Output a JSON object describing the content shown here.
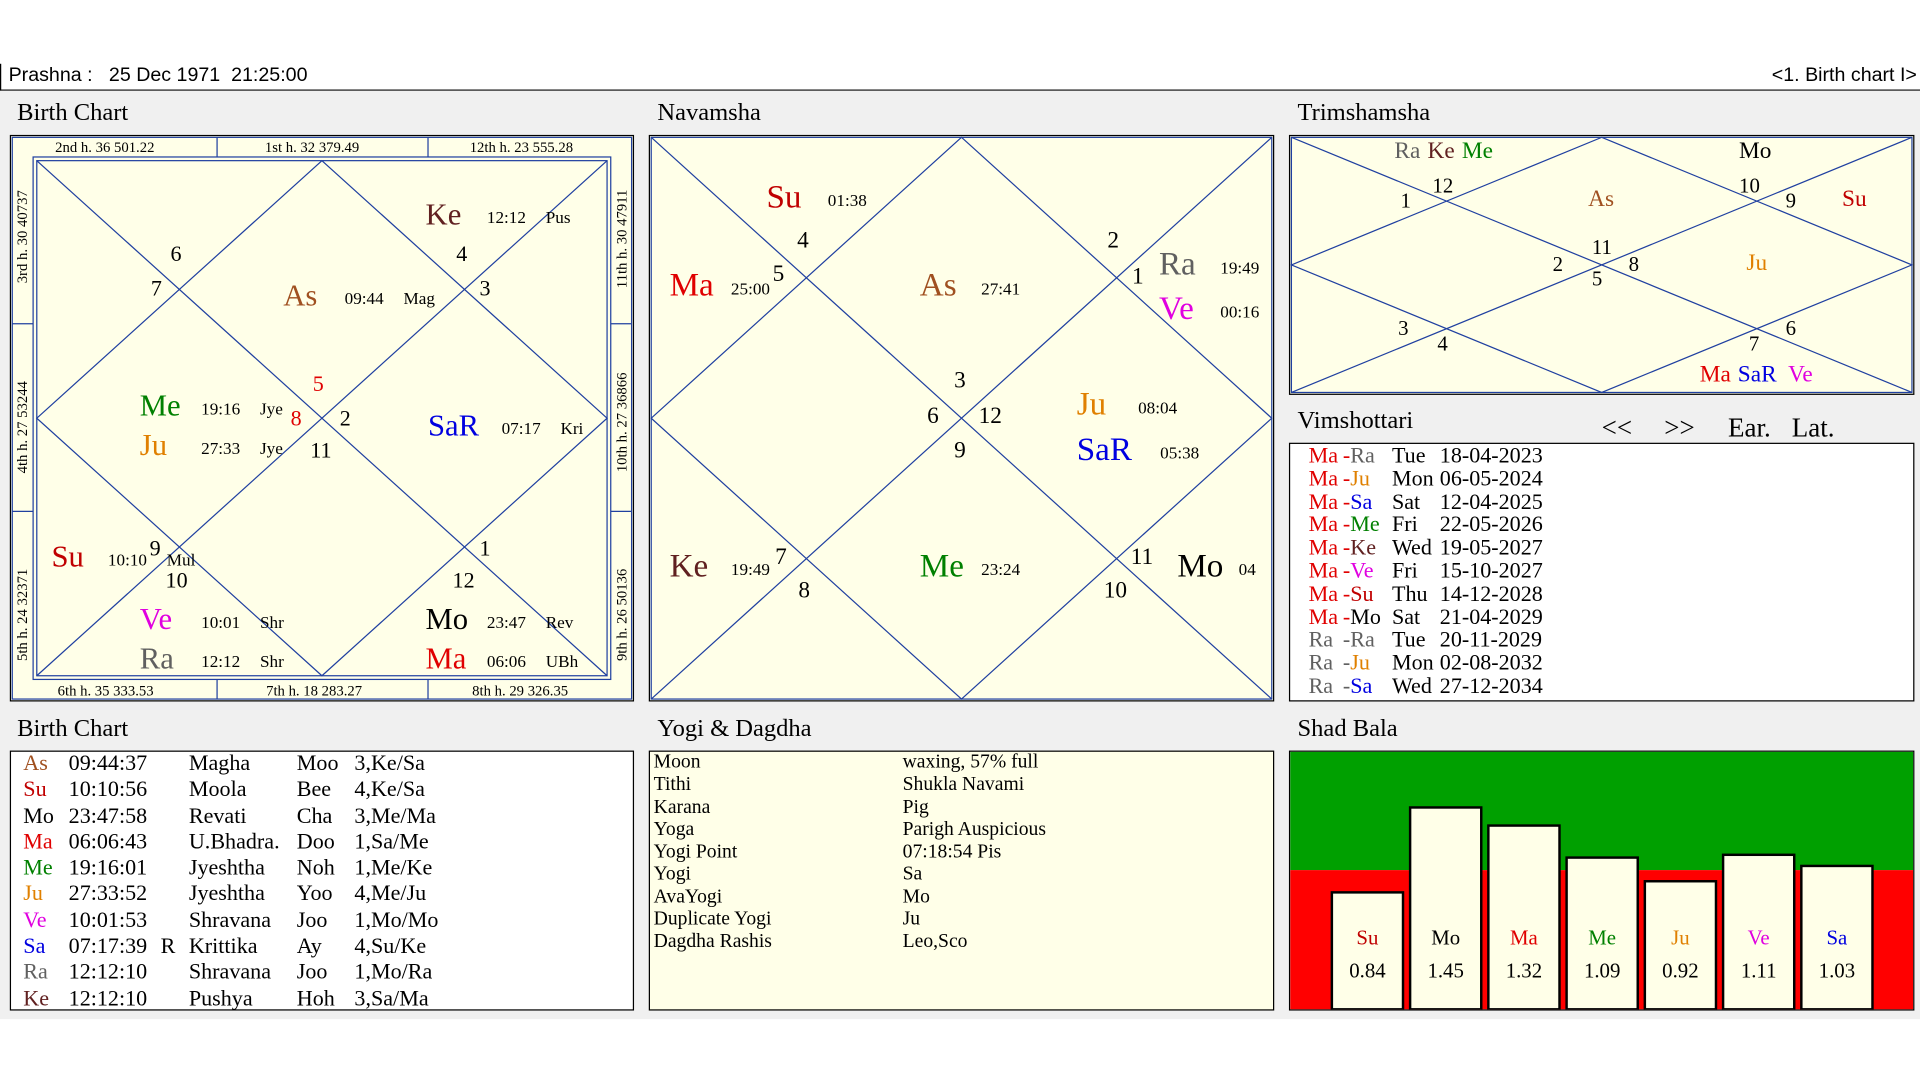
{
  "titlebar": {
    "left": "Prashna :   25 Dec 1971  21:25:00",
    "right": "<1. Birth chart I>"
  },
  "colors": {
    "Su": "#c00000",
    "Mo": "#000000",
    "Ma": "#e00000",
    "Me": "#008000",
    "Ju": "#e08000",
    "Ve": "#e000e0",
    "Sa": "#0000e0",
    "SaR": "#0000e0",
    "Ra": "#606060",
    "Ke": "#602020",
    "As": "#a05020",
    "chartbg": "#ffffe8"
  },
  "birth_chart": {
    "title": "Birth Chart",
    "houses": {
      "h2": "2nd h.  36  501.22",
      "h1": "1st h.  32  379.49",
      "h12": "12th h.  23  555.28",
      "h3": "3rd h.  30 40737",
      "h4": "4th h.  27  53244",
      "h5": "5th h.  24 32371",
      "h11": "11th h.  30 47911",
      "h10": "10th h.  27 36866",
      "h9": "9th h.  26 50136",
      "h6": "6th h.  35  333.53",
      "h7": "7th h.  18  283.27",
      "h8": "8th h.  29  326.35"
    },
    "numbers": [
      "6",
      "7",
      "4",
      "3",
      "5",
      "8",
      "2",
      "11",
      "9",
      "10",
      "1",
      "12"
    ],
    "planets": [
      {
        "p": "Ke",
        "deg": "12:12",
        "nak": "Pus"
      },
      {
        "p": "As",
        "deg": "09:44",
        "nak": "Mag"
      },
      {
        "p": "Me",
        "deg": "19:16",
        "nak": "Jye"
      },
      {
        "p": "Ju",
        "deg": "27:33",
        "nak": "Jye"
      },
      {
        "p": "SaR",
        "deg": "07:17",
        "nak": "Kri"
      },
      {
        "p": "Su",
        "deg": "10:10",
        "nak": "Mul"
      },
      {
        "p": "Ve",
        "deg": "10:01",
        "nak": "Shr"
      },
      {
        "p": "Ra",
        "deg": "12:12",
        "nak": "Shr"
      },
      {
        "p": "Mo",
        "deg": "23:47",
        "nak": "Rev"
      },
      {
        "p": "Ma",
        "deg": "06:06",
        "nak": "UBh"
      }
    ]
  },
  "navamsha": {
    "title": "Navamsha",
    "numbers": [
      "4",
      "5",
      "2",
      "1",
      "3",
      "6",
      "12",
      "9",
      "7",
      "8",
      "11",
      "10"
    ],
    "planets": [
      {
        "p": "Su",
        "deg": "01:38"
      },
      {
        "p": "Ma",
        "deg": "25:00"
      },
      {
        "p": "As",
        "deg": "27:41"
      },
      {
        "p": "Ra",
        "deg": "19:49"
      },
      {
        "p": "Ve",
        "deg": "00:16"
      },
      {
        "p": "Ju",
        "deg": "08:04"
      },
      {
        "p": "SaR",
        "deg": "05:38"
      },
      {
        "p": "Ke",
        "deg": "19:49"
      },
      {
        "p": "Me",
        "deg": "23:24"
      },
      {
        "p": "Mo",
        "deg": "04"
      }
    ]
  },
  "trimshamsha": {
    "title": "Trimshamsha",
    "numbers": [
      "12",
      "1",
      "10",
      "9",
      "11",
      "2",
      "8",
      "5",
      "3",
      "4",
      "6",
      "7"
    ],
    "planets": [
      "Ra",
      "Ke",
      "Me",
      "Mo",
      "As",
      "Su",
      "Ju",
      "Ma",
      "SaR",
      "Ve"
    ]
  },
  "vimshottari": {
    "title": "Vimshottari",
    "nav_prev": "<<",
    "nav_next": ">>",
    "ear": "Ear.",
    "lat": "Lat.",
    "rows": [
      {
        "a": "Ma",
        "b": "Ra",
        "day": "Tue",
        "date": "18-04-2023"
      },
      {
        "a": "Ma",
        "b": "Ju",
        "day": "Mon",
        "date": "06-05-2024"
      },
      {
        "a": "Ma",
        "b": "Sa",
        "day": "Sat",
        "date": "12-04-2025"
      },
      {
        "a": "Ma",
        "b": "Me",
        "day": "Fri",
        "date": "22-05-2026"
      },
      {
        "a": "Ma",
        "b": "Ke",
        "day": "Wed",
        "date": "19-05-2027"
      },
      {
        "a": "Ma",
        "b": "Ve",
        "day": "Fri",
        "date": "15-10-2027"
      },
      {
        "a": "Ma",
        "b": "Su",
        "day": "Thu",
        "date": "14-12-2028"
      },
      {
        "a": "Ma",
        "b": "Mo",
        "day": "Sat",
        "date": "21-04-2029"
      },
      {
        "a": "Ra",
        "b": "Ra",
        "day": "Tue",
        "date": "20-11-2029"
      },
      {
        "a": "Ra",
        "b": "Ju",
        "day": "Mon",
        "date": "02-08-2032"
      },
      {
        "a": "Ra",
        "b": "Sa",
        "day": "Wed",
        "date": "27-12-2034"
      }
    ]
  },
  "birth_table": {
    "title": "Birth Chart",
    "rows": [
      {
        "p": "As",
        "deg": "09:44:37",
        "r": "",
        "nak": "Magha",
        "sy": "Moo",
        "pada": "3,Ke/Sa"
      },
      {
        "p": "Su",
        "deg": "10:10:56",
        "r": "",
        "nak": "Moola",
        "sy": "Bee",
        "pada": "4,Ke/Sa"
      },
      {
        "p": "Mo",
        "deg": "23:47:58",
        "r": "",
        "nak": "Revati",
        "sy": "Cha",
        "pada": "3,Me/Ma"
      },
      {
        "p": "Ma",
        "deg": "06:06:43",
        "r": "",
        "nak": "U.Bhadra.",
        "sy": "Doo",
        "pada": "1,Sa/Me"
      },
      {
        "p": "Me",
        "deg": "19:16:01",
        "r": "",
        "nak": "Jyeshtha",
        "sy": "Noh",
        "pada": "1,Me/Ke"
      },
      {
        "p": "Ju",
        "deg": "27:33:52",
        "r": "",
        "nak": "Jyeshtha",
        "sy": "Yoo",
        "pada": "4,Me/Ju"
      },
      {
        "p": "Ve",
        "deg": "10:01:53",
        "r": "",
        "nak": "Shravana",
        "sy": "Joo",
        "pada": "1,Mo/Mo"
      },
      {
        "p": "Sa",
        "deg": "07:17:39",
        "r": "R",
        "nak": "Krittika",
        "sy": "Ay",
        "pada": "4,Su/Ke"
      },
      {
        "p": "Ra",
        "deg": "12:12:10",
        "r": "",
        "nak": "Shravana",
        "sy": "Joo",
        "pada": "1,Mo/Ra"
      },
      {
        "p": "Ke",
        "deg": "12:12:10",
        "r": "",
        "nak": "Pushya",
        "sy": "Hoh",
        "pada": "3,Sa/Ma"
      }
    ]
  },
  "yogi": {
    "title": "Yogi & Dagdha",
    "rows": [
      {
        "k": "Moon",
        "v": "waxing, 57% full"
      },
      {
        "k": "Tithi",
        "v": "Shukla  Navami"
      },
      {
        "k": "Karana",
        "v": "Pig"
      },
      {
        "k": "Yoga",
        "v": "Parigh Auspicious"
      },
      {
        "k": "Yogi Point",
        "v": "07:18:54 Pis"
      },
      {
        "k": "Yogi",
        "v": "Sa"
      },
      {
        "k": "AvaYogi",
        "v": "Mo"
      },
      {
        "k": "Duplicate Yogi",
        "v": "Ju"
      },
      {
        "k": "Dagdha Rashis",
        "v": "Leo,Sco"
      }
    ]
  },
  "chart_data": {
    "type": "bar",
    "title": "Shad Bala",
    "categories": [
      "Su",
      "Mo",
      "Ma",
      "Me",
      "Ju",
      "Ve",
      "Sa"
    ],
    "values": [
      0.84,
      1.45,
      1.32,
      1.09,
      0.92,
      1.11,
      1.03
    ],
    "value_labels": [
      "0.84",
      "1.45",
      "1.32",
      "1.09",
      "0.92",
      "1.11",
      "1.03"
    ],
    "threshold": 1.0,
    "ylim": [
      0,
      1.85
    ],
    "colors": {
      "upper": "#00a000",
      "lower": "#ff0000",
      "bar": "#ffffe8"
    }
  }
}
